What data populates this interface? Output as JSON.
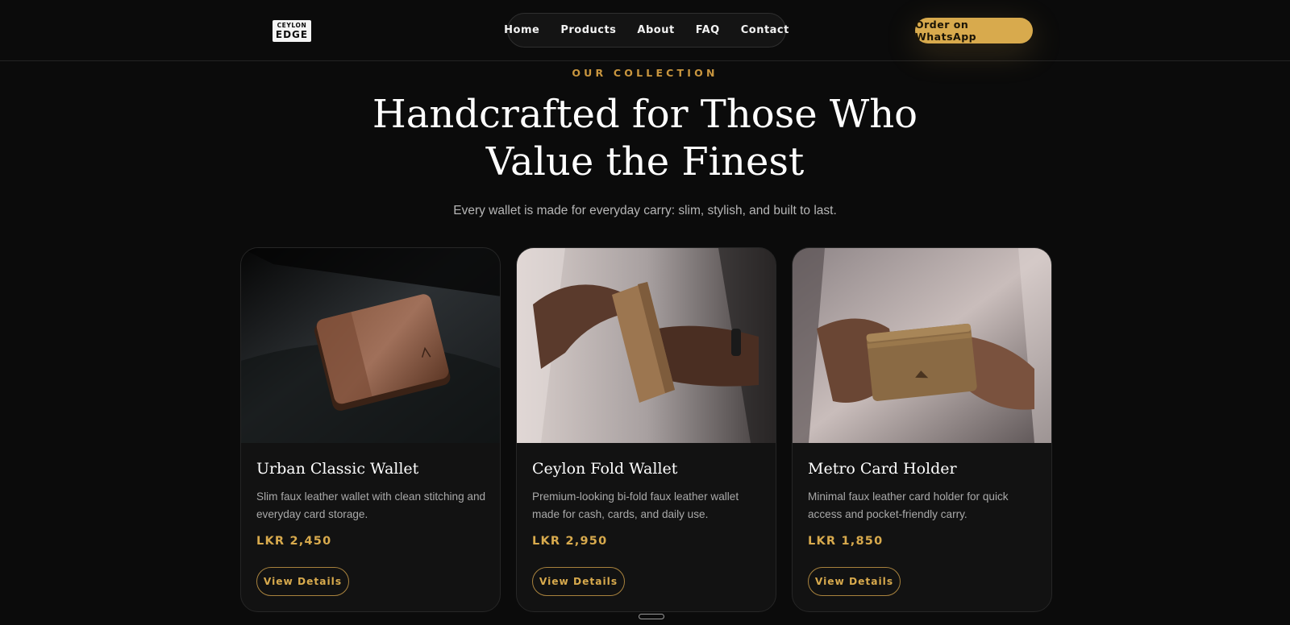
{
  "brand": {
    "logo_line1": "CEYLON",
    "logo_line2": "EDGE"
  },
  "nav": {
    "items": [
      "Home",
      "Products",
      "About",
      "FAQ",
      "Contact"
    ]
  },
  "cta": {
    "label": "Order on WhatsApp",
    "color": "#d8aa4d"
  },
  "hero": {
    "eyebrow": "OUR COLLECTION",
    "headline_line1": "Handcrafted for Those Who",
    "headline_line2": "Value the Finest",
    "subhead": "Every wallet is made for everyday carry: slim, stylish, and built to last."
  },
  "products": [
    {
      "name": "Urban Classic Wallet",
      "description": "Slim faux leather wallet with clean stitching and everyday card storage.",
      "price": "LKR 2,450",
      "button": "View Details"
    },
    {
      "name": "Ceylon Fold Wallet",
      "description": "Premium-looking bi-fold faux leather wallet made for cash, cards, and daily use.",
      "price": "LKR 2,950",
      "button": "View Details"
    },
    {
      "name": "Metro Card Holder",
      "description": "Minimal faux leather card holder for quick access and pocket-friendly carry.",
      "price": "LKR 1,850",
      "button": "View Details"
    }
  ],
  "colors": {
    "background": "#0b0b0b",
    "accent": "#d8aa4d",
    "card": "#121212"
  }
}
